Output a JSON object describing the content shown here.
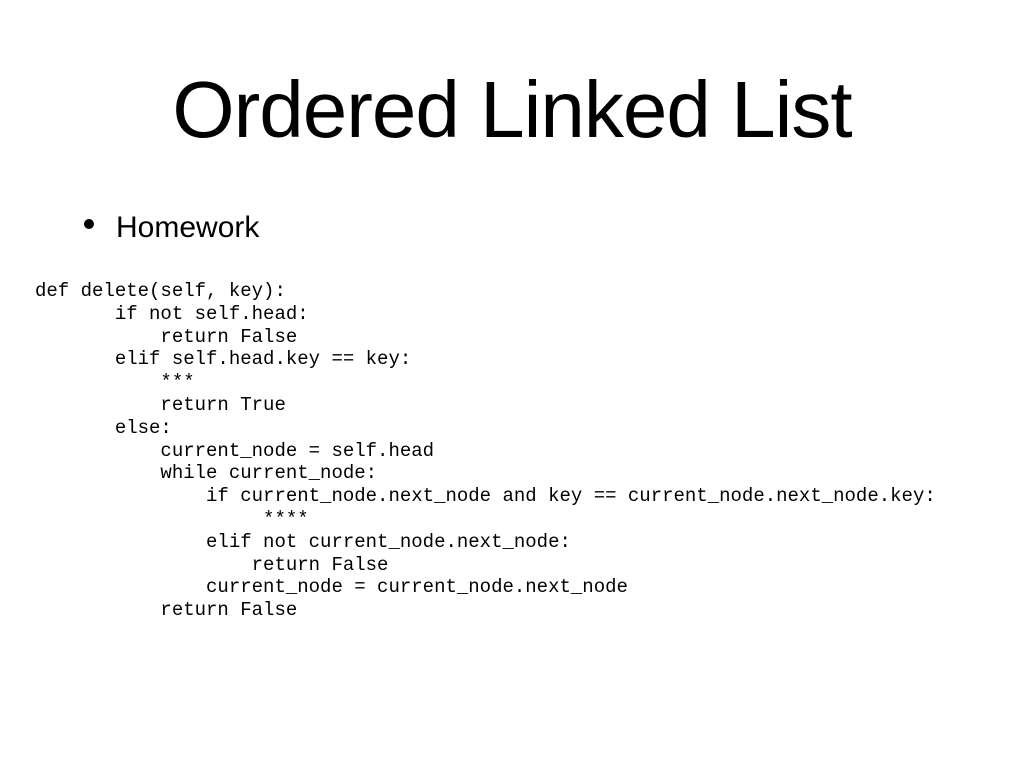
{
  "slide": {
    "title": "Ordered Linked List",
    "bullets": [
      {
        "icon": "bullet-dot",
        "text": "Homework"
      }
    ],
    "code_lines": [
      "def delete(self, key):",
      "       if not self.head:",
      "           return False",
      "       elif self.head.key == key:",
      "           ***",
      "           return True",
      "       else:",
      "           current_node = self.head",
      "           while current_node:",
      "               if current_node.next_node and key == current_node.next_node.key:",
      "                    ****",
      "               elif not current_node.next_node:",
      "                   return False",
      "               current_node = current_node.next_node",
      "           return False"
    ]
  }
}
